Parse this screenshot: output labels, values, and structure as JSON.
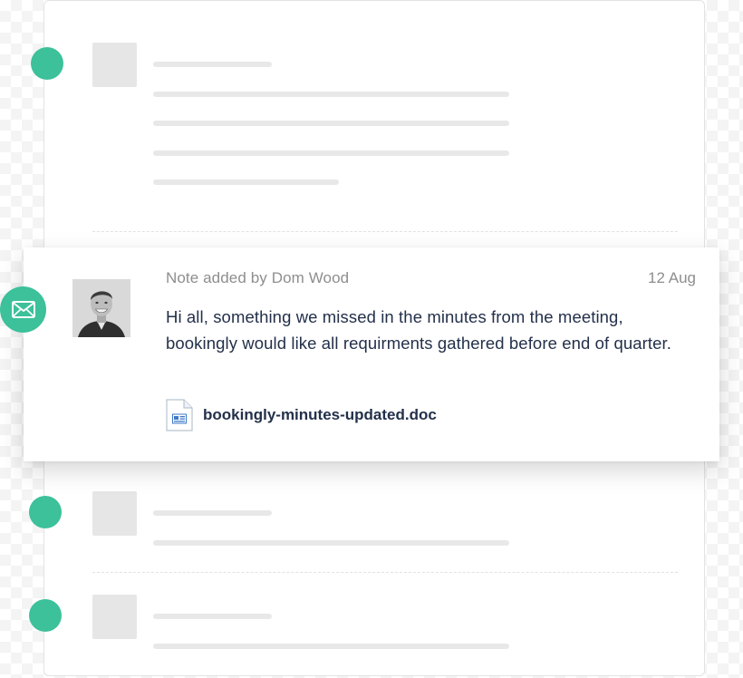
{
  "note": {
    "meta": "Note added by Dom Wood",
    "date": "12 Aug",
    "body": "Hi all, something we missed in the minutes from the meeting, bookingly would like all requirments gathered before end of quarter.",
    "attachment": {
      "filename": "bookingly-minutes-updated.doc",
      "icon": "document-icon"
    },
    "badge_icon": "envelope-icon",
    "avatar_alt": "Dom Wood"
  },
  "colors": {
    "accent": "#3cc19a",
    "text_dark": "#23304a",
    "text_muted": "#8e8e8e",
    "placeholder": "#e8e8e8"
  }
}
